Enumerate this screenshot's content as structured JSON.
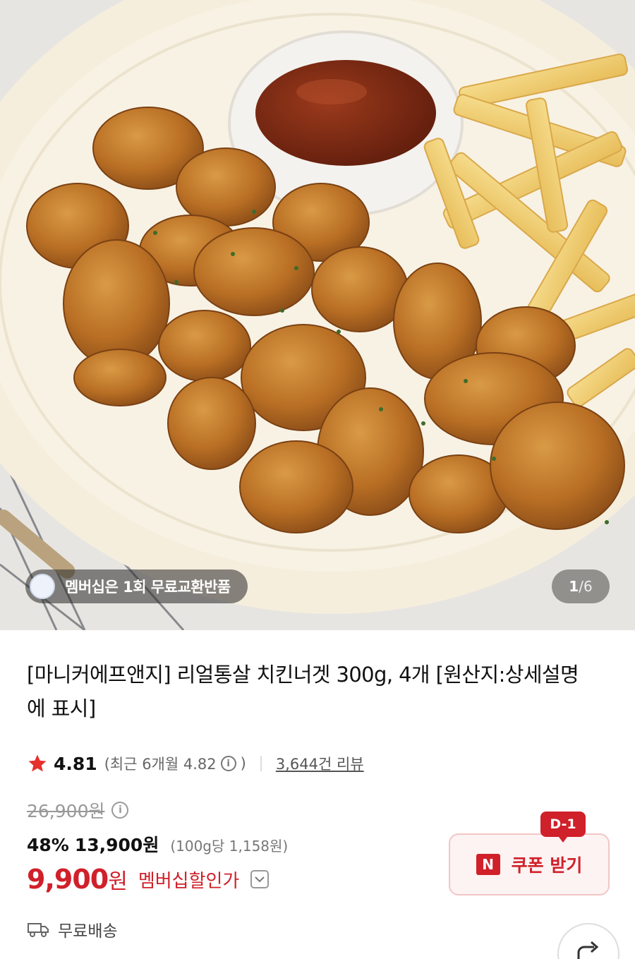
{
  "hero": {
    "member_badge": "멤버십은 1회 무료교환반품",
    "counter": {
      "current": "1",
      "separator": "/",
      "total": "6"
    }
  },
  "product": {
    "title": "[마니커에프앤지] 리얼통살 치킨너겟 300g, 4개 [원산지:상세설명에 표시]",
    "rating": "4.81",
    "recent_rating": "(최근 6개월 4.82",
    "recent_close": ")",
    "review_count": "3,644건 리뷰"
  },
  "price": {
    "original": "26,900원",
    "discount_rate": "48%",
    "sale_price": "13,900원",
    "unit_price": "(100g당 1,158원)",
    "member_price_number": "9,900",
    "member_price_unit": "원",
    "member_label": "멤버십할인가"
  },
  "coupon": {
    "badge": "D-1",
    "logo": "N",
    "label": "쿠폰 받기"
  },
  "shipping": {
    "label": "무료배송"
  },
  "icons": {
    "star": "star-icon",
    "info": "info-icon",
    "dropdown": "chevron-down-icon",
    "truck": "truck-icon",
    "share": "share-icon"
  },
  "colors": {
    "accent_red": "#d0202a",
    "coupon_bg": "#fdf3f3",
    "star": "#e5302b"
  }
}
